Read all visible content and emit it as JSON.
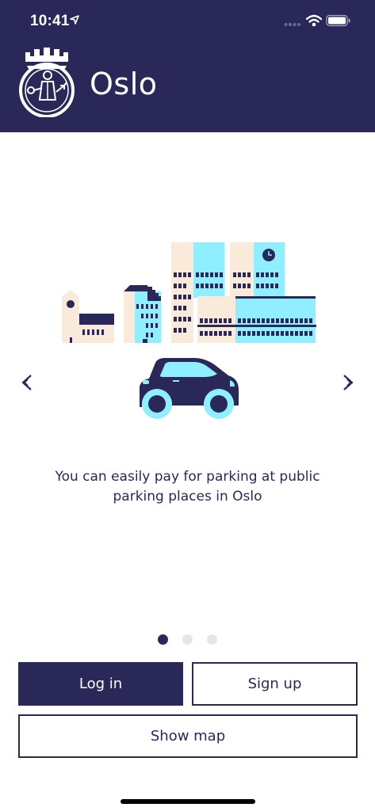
{
  "status_bar": {
    "time": "10:41",
    "icons": [
      "location-arrow-icon",
      "cellular-signal-icon",
      "wifi-icon",
      "battery-icon"
    ]
  },
  "header": {
    "logo": "oslo-city-crest",
    "title": "Oslo"
  },
  "onboarding": {
    "illustration": "city-buildings-and-car",
    "text": "You can easily pay for parking at public parking places in Oslo",
    "page_count": 3,
    "current_page": 1,
    "prev_icon": "chevron-left-icon",
    "next_icon": "chevron-right-icon"
  },
  "actions": {
    "login_label": "Log in",
    "signup_label": "Sign up",
    "show_map_label": "Show map"
  },
  "colors": {
    "primary": "#2a2859",
    "light_blue": "#8fefff",
    "beige": "#f9ead9",
    "inactive_dot": "#e6e6e6"
  }
}
